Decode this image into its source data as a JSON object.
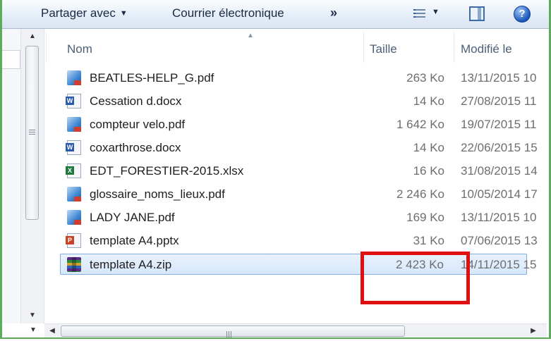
{
  "toolbar": {
    "share_label": "Partager avec",
    "email_label": "Courrier électronique",
    "more_label": "»",
    "help_label": "?"
  },
  "columns": {
    "name": "Nom",
    "size": "Taille",
    "modified": "Modifié le"
  },
  "files": [
    {
      "name": "BEATLES-HELP_G.pdf",
      "type": "pdf",
      "size": "263 Ko",
      "modified": "13/11/2015 10"
    },
    {
      "name": "Cessation d.docx",
      "type": "docx",
      "size": "14 Ko",
      "modified": "27/08/2015 11"
    },
    {
      "name": "compteur velo.pdf",
      "type": "pdf",
      "size": "1 642 Ko",
      "modified": "19/07/2015 11"
    },
    {
      "name": "coxarthrose.docx",
      "type": "docx",
      "size": "14 Ko",
      "modified": "22/06/2015 15"
    },
    {
      "name": "EDT_FORESTIER-2015.xlsx",
      "type": "xlsx",
      "size": "16 Ko",
      "modified": "31/08/2015 14"
    },
    {
      "name": "glossaire_noms_lieux.pdf",
      "type": "pdf",
      "size": "2 246 Ko",
      "modified": "10/05/2014 17"
    },
    {
      "name": "LADY JANE.pdf",
      "type": "pdf",
      "size": "169 Ko",
      "modified": "13/11/2015 10"
    },
    {
      "name": "template A4.pptx",
      "type": "pptx",
      "size": "31 Ko",
      "modified": "07/06/2015 13"
    },
    {
      "name": "template A4.zip",
      "type": "zip",
      "size": "2 423 Ko",
      "modified": "14/11/2015 15",
      "selected": true
    }
  ],
  "icons": {
    "pdf": "pdf-file-icon",
    "docx": "word-document-icon",
    "xlsx": "excel-spreadsheet-icon",
    "pptx": "powerpoint-presentation-icon",
    "zip": "winrar-archive-icon"
  },
  "colors": {
    "highlight": "#e01010",
    "frame": "#5aae5a",
    "selection": "#d6e7fb"
  }
}
